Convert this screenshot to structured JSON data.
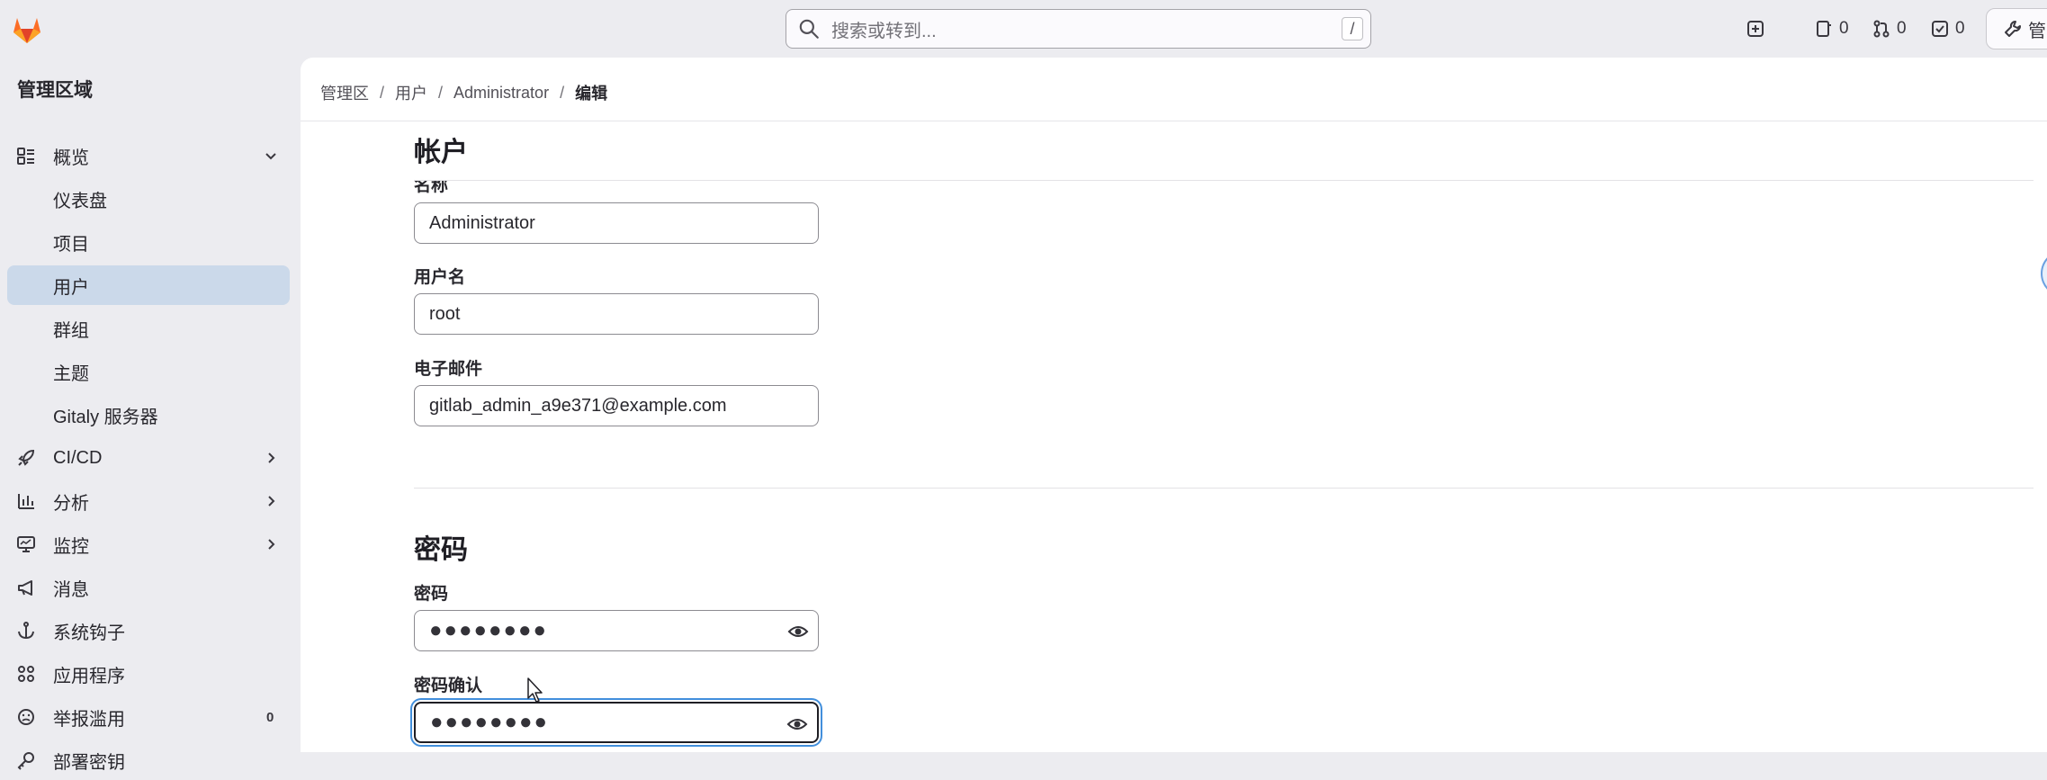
{
  "search": {
    "placeholder": "搜索或转到...",
    "shortcut": "/"
  },
  "topbar": {
    "issues_count": "0",
    "merge_requests_count": "0",
    "todos_count": "0",
    "admin_label": "管"
  },
  "sidebar": {
    "title": "管理区域",
    "items": [
      {
        "label": "概览",
        "icon": "overview-icon",
        "expanded": true
      },
      {
        "label": "仪表盘",
        "sub": true
      },
      {
        "label": "项目",
        "sub": true
      },
      {
        "label": "用户",
        "sub": true,
        "active": true
      },
      {
        "label": "群组",
        "sub": true
      },
      {
        "label": "主题",
        "sub": true
      },
      {
        "label": "Gitaly 服务器",
        "sub": true
      },
      {
        "label": "CI/CD",
        "icon": "rocket-icon"
      },
      {
        "label": "分析",
        "icon": "chart-icon"
      },
      {
        "label": "监控",
        "icon": "monitor-icon"
      },
      {
        "label": "消息",
        "icon": "megaphone-icon"
      },
      {
        "label": "系统钩子",
        "icon": "anchor-icon"
      },
      {
        "label": "应用程序",
        "icon": "apps-icon"
      },
      {
        "label": "举报滥用",
        "icon": "abuse-icon",
        "count": "0"
      },
      {
        "label": "部署密钥",
        "icon": "key-icon"
      }
    ]
  },
  "breadcrumb": [
    "管理区",
    "用户",
    "Administrator",
    "编辑"
  ],
  "account": {
    "title": "帐户",
    "name_label": "名称",
    "name_value": "Administrator",
    "username_label": "用户名",
    "username_value": "root",
    "email_label": "电子邮件",
    "email_value": "gitlab_admin_a9e371@example.com"
  },
  "password": {
    "title": "密码",
    "password_label": "密码",
    "password_value": "●●●●●●●●",
    "confirm_label": "密码确认",
    "confirm_value": "●●●●●●●●"
  }
}
